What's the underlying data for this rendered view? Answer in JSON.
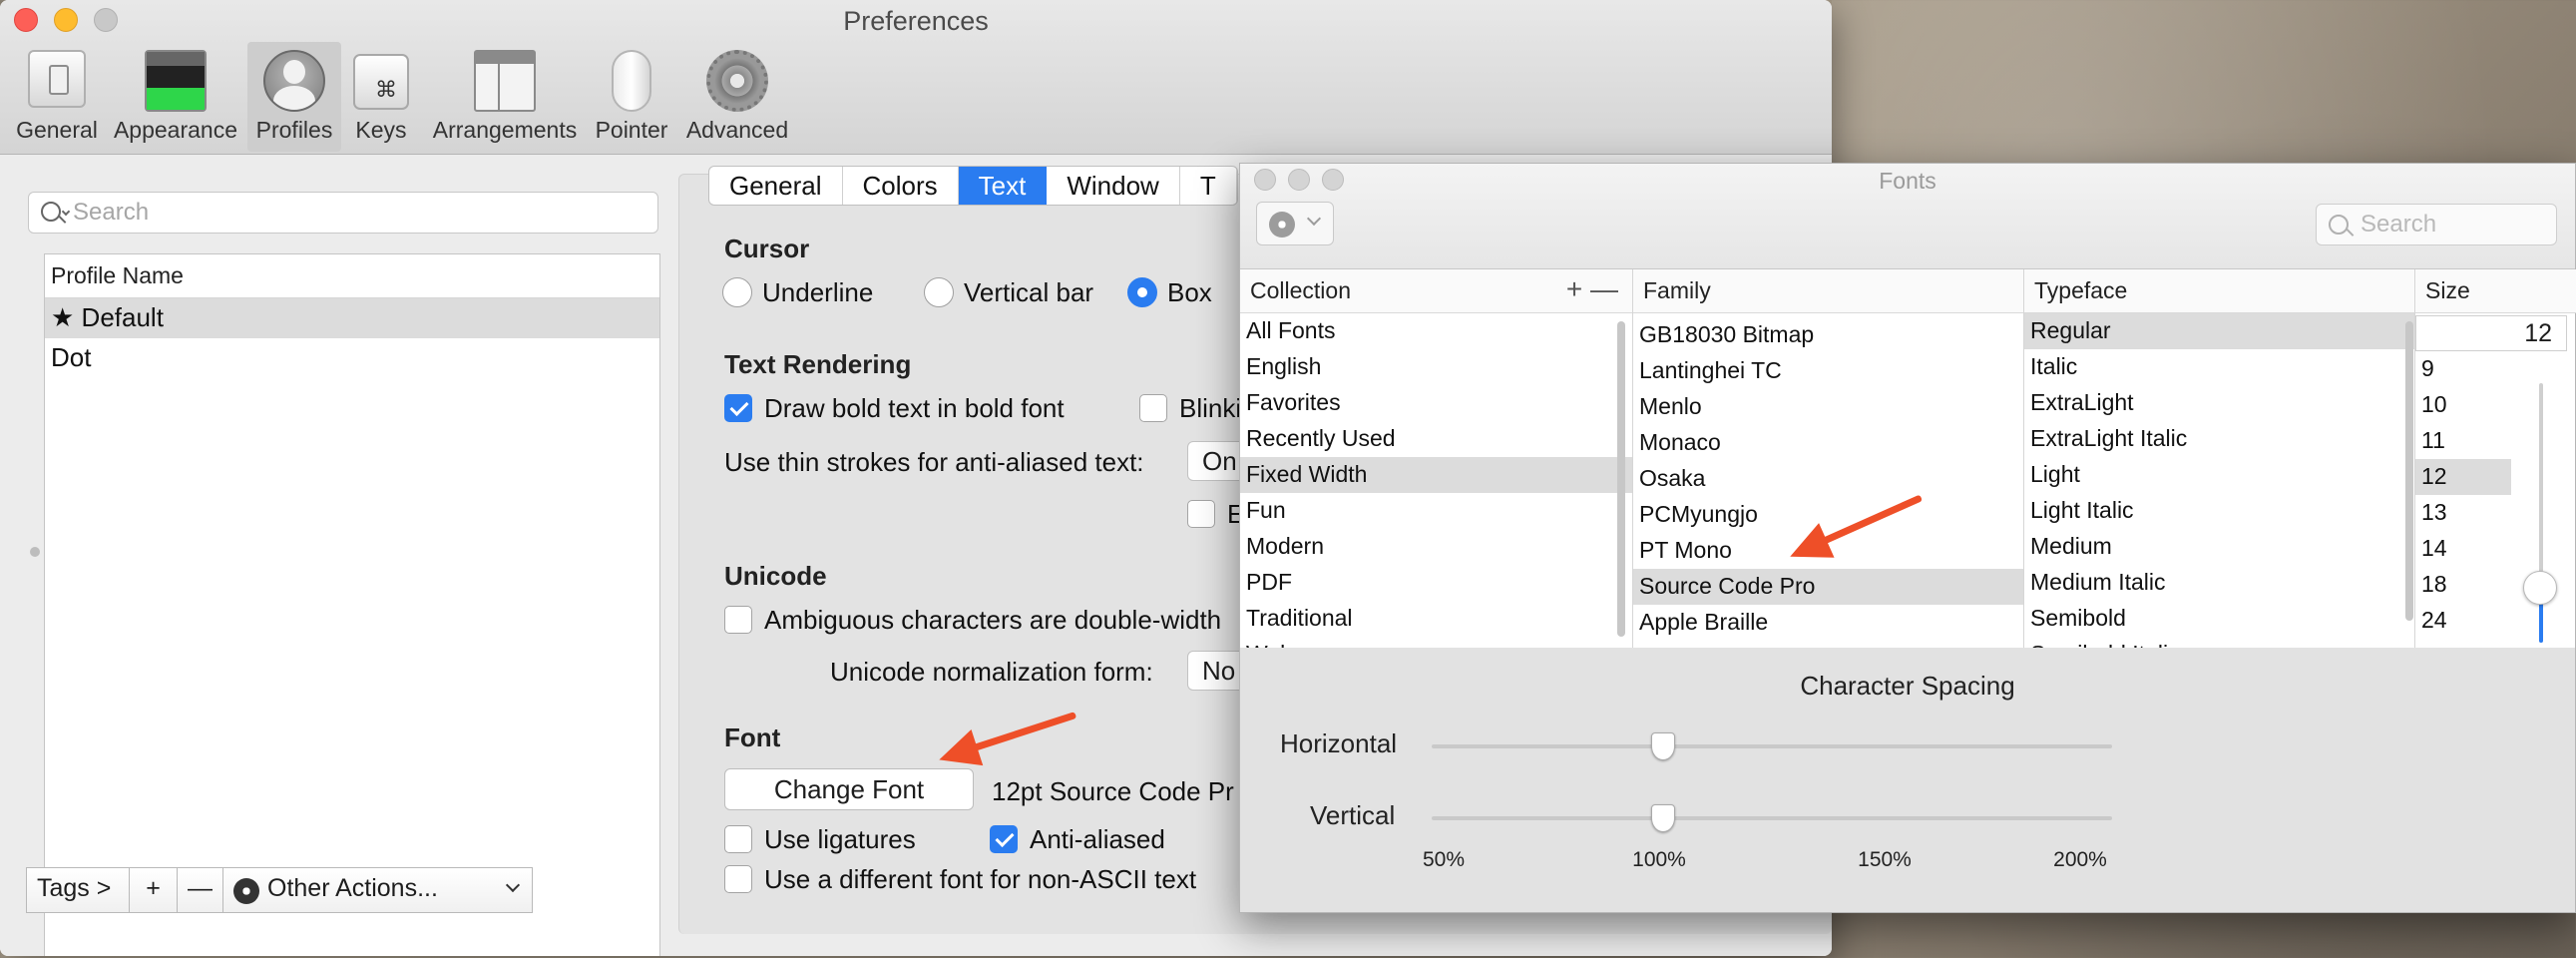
{
  "prefs": {
    "title": "Preferences",
    "toolbar": [
      {
        "label": "General",
        "icon": "general-icon"
      },
      {
        "label": "Appearance",
        "icon": "appearance-icon"
      },
      {
        "label": "Profiles",
        "icon": "profiles-icon"
      },
      {
        "label": "Keys",
        "icon": "keys-icon"
      },
      {
        "label": "Arrangements",
        "icon": "arrangements-icon"
      },
      {
        "label": "Pointer",
        "icon": "pointer-icon"
      },
      {
        "label": "Advanced",
        "icon": "advanced-icon"
      }
    ],
    "keys_glyph": "⌘",
    "search": {
      "placeholder": "Search"
    },
    "profiles": {
      "header": "Profile Name",
      "rows": [
        "Default",
        "Dot"
      ],
      "default_star": "★"
    },
    "bottom": {
      "tags": "Tags >",
      "plus": "+",
      "minus": "—",
      "other": "Other Actions..."
    },
    "tabs": [
      "General",
      "Colors",
      "Text",
      "Window",
      "T"
    ],
    "cursor": {
      "title": "Cursor",
      "options": [
        "Underline",
        "Vertical bar",
        "Box"
      ],
      "selected": "Box"
    },
    "rendering": {
      "title": "Text Rendering",
      "bold": "Draw bold text in bold font",
      "blink": "Blinki",
      "thin_label": "Use thin strokes for anti-aliased text:",
      "thin_value": "On",
      "extra": "E"
    },
    "unicode": {
      "title": "Unicode",
      "ambiguous": "Ambiguous characters are double-width",
      "norm_label": "Unicode normalization form:",
      "norm_value": "No"
    },
    "font": {
      "title": "Font",
      "change": "Change Font",
      "current": "12pt Source Code Pr",
      "ligatures": "Use ligatures",
      "antialiased": "Anti-aliased",
      "non_ascii": "Use a different font for non-ASCII text"
    }
  },
  "fonts_panel": {
    "title": "Fonts",
    "search": {
      "placeholder": "Search"
    },
    "collection": {
      "header": "Collection",
      "plus": "+",
      "minus": "—",
      "items": [
        "All Fonts",
        "English",
        "Favorites",
        "Recently Used",
        "Fixed Width",
        "Fun",
        "Modern",
        "PDF",
        "Traditional",
        "Web"
      ],
      "selected": "Fixed Width"
    },
    "family": {
      "header": "Family",
      "items": [
        "GB18030 Bitmap",
        "Lantinghei TC",
        "Menlo",
        "Monaco",
        "Osaka",
        "PCMyungjo",
        "PT Mono",
        "Source Code Pro",
        "Apple Braille"
      ],
      "selected": "Source Code Pro"
    },
    "typeface": {
      "header": "Typeface",
      "items": [
        "Regular",
        "Italic",
        "ExtraLight",
        "ExtraLight Italic",
        "Light",
        "Light Italic",
        "Medium",
        "Medium Italic",
        "Semibold",
        "Semibold Italic"
      ],
      "selected": "Regular"
    },
    "size": {
      "header": "Size",
      "value": "12",
      "items": [
        "9",
        "10",
        "11",
        "12",
        "13",
        "14",
        "18",
        "24"
      ],
      "selected": "12"
    },
    "spacing": {
      "title": "Character Spacing",
      "horizontal": "Horizontal",
      "vertical": "Vertical",
      "marks": [
        "50%",
        "100%",
        "150%",
        "200%"
      ],
      "horizontal_value": "100%",
      "vertical_value": "100%"
    }
  },
  "colors": {
    "accent": "#2a7cf0",
    "arrow": "#ee4f28"
  }
}
